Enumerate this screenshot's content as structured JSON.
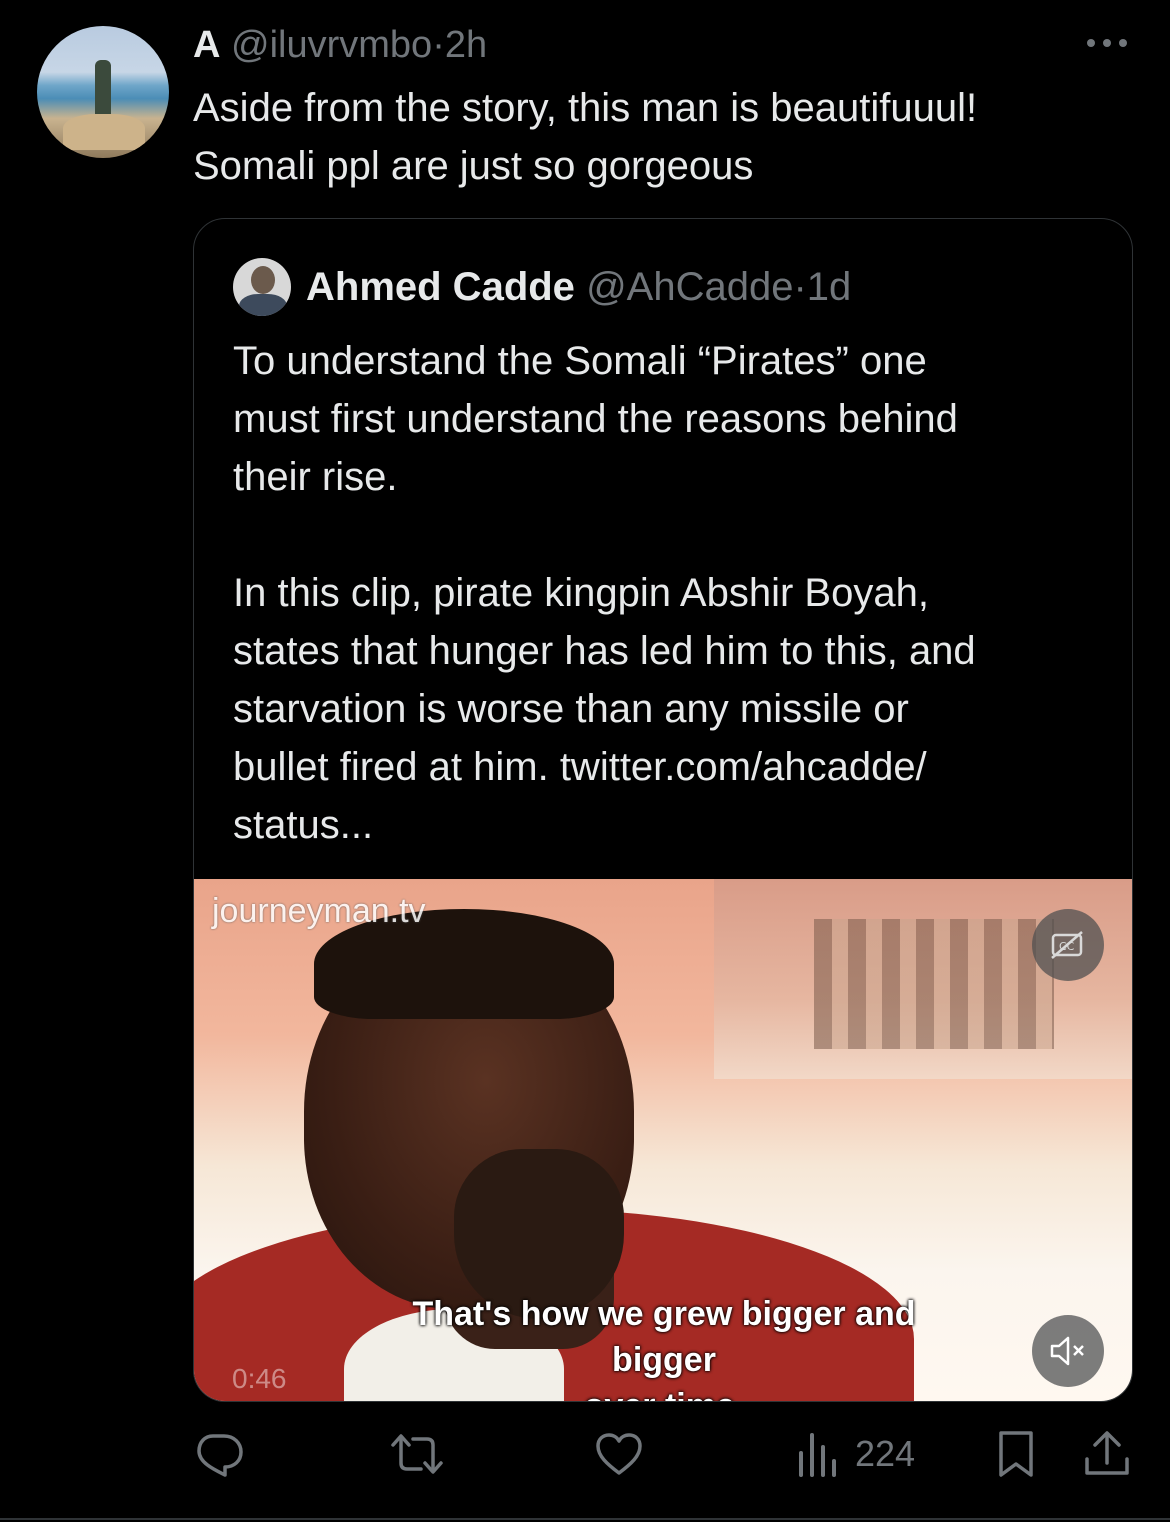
{
  "tweet": {
    "author_name": "A",
    "author_handle": "@iluvrvmbo",
    "separator": "·",
    "time": "2h",
    "text_line1": "Aside from the story, this man is beautifuuul!",
    "text_line2": "Somali ppl are just so gorgeous",
    "more_icon": "more-dots-icon"
  },
  "quoted": {
    "author_name": "Ahmed Cadde",
    "author_handle": "@AhCadde",
    "separator": "·",
    "time": "1d",
    "text": "To understand the Somali “Pirates” one\nmust first understand the reasons behind\ntheir rise.\n\nIn this clip, pirate kingpin Abshir Boyah,\nstates that hunger has led him to this, and\nstarvation is worse than any missile or\nbullet fired at him. twitter.com/ahcadde/\nstatus...",
    "video": {
      "watermark": "journeyman.tv",
      "subtitle_line1": "That's how we grew bigger and bigger",
      "subtitle_line2": "over time.",
      "duration": "0:46",
      "cc_icon": "captions-off-icon",
      "mute_icon": "volume-muted-icon"
    }
  },
  "actions": {
    "reply_icon": "reply-icon",
    "retweet_icon": "retweet-icon",
    "like_icon": "heart-icon",
    "views_icon": "views-icon",
    "views_count": "224",
    "bookmark_icon": "bookmark-icon",
    "share_icon": "share-icon"
  },
  "colors": {
    "background": "#000000",
    "text_primary": "#e7e9ea",
    "text_secondary": "#71767b",
    "border": "#2f3336"
  }
}
